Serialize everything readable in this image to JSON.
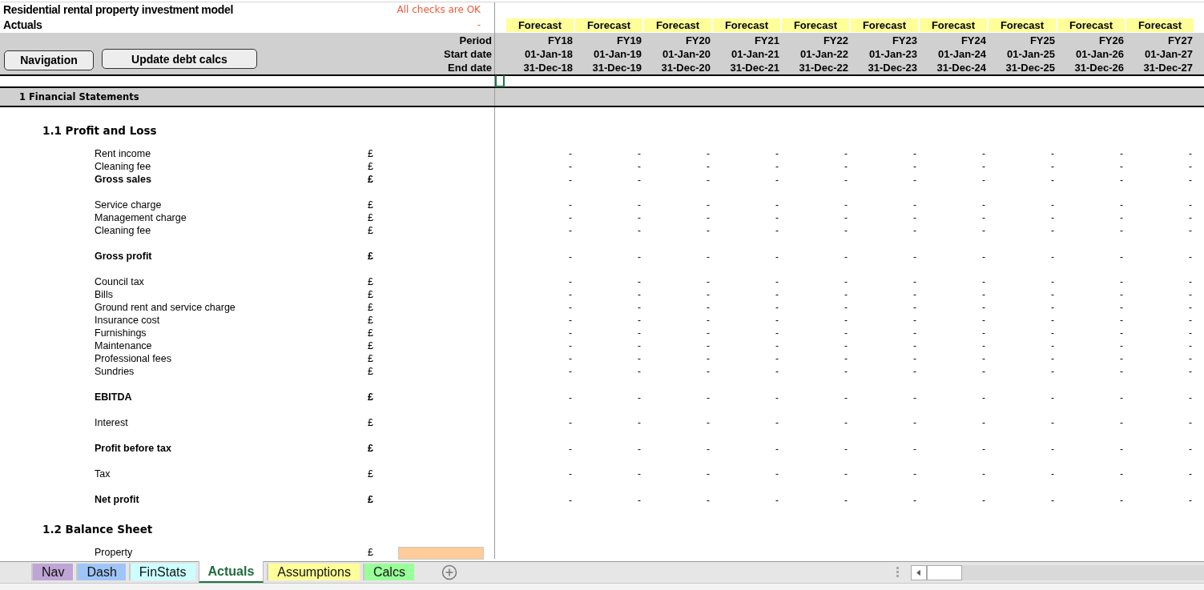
{
  "title": "Residential rental property investment model",
  "sheet_title": "Actuals",
  "check_status": "All checks are OK",
  "check_value": "-",
  "buttons": [
    "Navigation",
    "Update debt calcs"
  ],
  "header_labels": [
    "Period",
    "Start date",
    "End date"
  ],
  "periods": [
    {
      "flag": "Forecast",
      "period": "FY18",
      "start": "01-Jan-18",
      "end": "31-Dec-18"
    },
    {
      "flag": "Forecast",
      "period": "FY19",
      "start": "01-Jan-19",
      "end": "31-Dec-19"
    },
    {
      "flag": "Forecast",
      "period": "FY20",
      "start": "01-Jan-20",
      "end": "31-Dec-20"
    },
    {
      "flag": "Forecast",
      "period": "FY21",
      "start": "01-Jan-21",
      "end": "31-Dec-21"
    },
    {
      "flag": "Forecast",
      "period": "FY22",
      "start": "01-Jan-22",
      "end": "31-Dec-22"
    },
    {
      "flag": "Forecast",
      "period": "FY23",
      "start": "01-Jan-23",
      "end": "31-Dec-23"
    },
    {
      "flag": "Forecast",
      "period": "FY24",
      "start": "01-Jan-24",
      "end": "31-Dec-24"
    },
    {
      "flag": "Forecast",
      "period": "FY25",
      "start": "01-Jan-25",
      "end": "31-Dec-25"
    },
    {
      "flag": "Forecast",
      "period": "FY26",
      "start": "01-Jan-26",
      "end": "31-Dec-26"
    },
    {
      "flag": "Forecast",
      "period": "FY27",
      "start": "01-Jan-27",
      "end": "31-Dec-27"
    }
  ],
  "section": "1 Financial Statements",
  "subsections": [
    {
      "heading": "1.1 Profit and Loss",
      "rows": [
        {
          "kind": "item",
          "label": "Rent income",
          "unit": "£",
          "values": [
            "-",
            "-",
            "-",
            "-",
            "-",
            "-",
            "-",
            "-",
            "-",
            "-"
          ]
        },
        {
          "kind": "item",
          "label": "Cleaning fee",
          "unit": "£",
          "values": [
            "-",
            "-",
            "-",
            "-",
            "-",
            "-",
            "-",
            "-",
            "-",
            "-"
          ]
        },
        {
          "kind": "total",
          "label": "Gross sales",
          "unit": "£",
          "values": [
            "-",
            "-",
            "-",
            "-",
            "-",
            "-",
            "-",
            "-",
            "-",
            "-"
          ]
        },
        {
          "kind": "spacer"
        },
        {
          "kind": "item",
          "label": "Service charge",
          "unit": "£",
          "values": [
            "-",
            "-",
            "-",
            "-",
            "-",
            "-",
            "-",
            "-",
            "-",
            "-"
          ]
        },
        {
          "kind": "item",
          "label": "Management charge",
          "unit": "£",
          "values": [
            "-",
            "-",
            "-",
            "-",
            "-",
            "-",
            "-",
            "-",
            "-",
            "-"
          ]
        },
        {
          "kind": "item",
          "label": "Cleaning fee",
          "unit": "£",
          "values": [
            "-",
            "-",
            "-",
            "-",
            "-",
            "-",
            "-",
            "-",
            "-",
            "-"
          ]
        },
        {
          "kind": "spacer"
        },
        {
          "kind": "total",
          "label": "Gross profit",
          "unit": "£",
          "values": [
            "-",
            "-",
            "-",
            "-",
            "-",
            "-",
            "-",
            "-",
            "-",
            "-"
          ]
        },
        {
          "kind": "spacer"
        },
        {
          "kind": "item",
          "label": "Council tax",
          "unit": "£",
          "values": [
            "-",
            "-",
            "-",
            "-",
            "-",
            "-",
            "-",
            "-",
            "-",
            "-"
          ]
        },
        {
          "kind": "item",
          "label": "Bills",
          "unit": "£",
          "values": [
            "-",
            "-",
            "-",
            "-",
            "-",
            "-",
            "-",
            "-",
            "-",
            "-"
          ]
        },
        {
          "kind": "item",
          "label": "Ground rent and service charge",
          "unit": "£",
          "values": [
            "-",
            "-",
            "-",
            "-",
            "-",
            "-",
            "-",
            "-",
            "-",
            "-"
          ]
        },
        {
          "kind": "item",
          "label": "Insurance cost",
          "unit": "£",
          "values": [
            "-",
            "-",
            "-",
            "-",
            "-",
            "-",
            "-",
            "-",
            "-",
            "-"
          ]
        },
        {
          "kind": "item",
          "label": "Furnishings",
          "unit": "£",
          "values": [
            "-",
            "-",
            "-",
            "-",
            "-",
            "-",
            "-",
            "-",
            "-",
            "-"
          ]
        },
        {
          "kind": "item",
          "label": "Maintenance",
          "unit": "£",
          "values": [
            "-",
            "-",
            "-",
            "-",
            "-",
            "-",
            "-",
            "-",
            "-",
            "-"
          ]
        },
        {
          "kind": "item",
          "label": "Professional fees",
          "unit": "£",
          "values": [
            "-",
            "-",
            "-",
            "-",
            "-",
            "-",
            "-",
            "-",
            "-",
            "-"
          ]
        },
        {
          "kind": "item",
          "label": "Sundries",
          "unit": "£",
          "values": [
            "-",
            "-",
            "-",
            "-",
            "-",
            "-",
            "-",
            "-",
            "-",
            "-"
          ]
        },
        {
          "kind": "spacer"
        },
        {
          "kind": "total",
          "label": "EBITDA",
          "unit": "£",
          "values": [
            "-",
            "-",
            "-",
            "-",
            "-",
            "-",
            "-",
            "-",
            "-",
            "-"
          ]
        },
        {
          "kind": "spacer"
        },
        {
          "kind": "item",
          "label": "Interest",
          "unit": "£",
          "values": [
            "-",
            "-",
            "-",
            "-",
            "-",
            "-",
            "-",
            "-",
            "-",
            "-"
          ]
        },
        {
          "kind": "spacer"
        },
        {
          "kind": "total",
          "label": "Profit before tax",
          "unit": "£",
          "values": [
            "-",
            "-",
            "-",
            "-",
            "-",
            "-",
            "-",
            "-",
            "-",
            "-"
          ]
        },
        {
          "kind": "spacer"
        },
        {
          "kind": "item",
          "label": "Tax",
          "unit": "£",
          "values": [
            "-",
            "-",
            "-",
            "-",
            "-",
            "-",
            "-",
            "-",
            "-",
            "-"
          ]
        },
        {
          "kind": "spacer"
        },
        {
          "kind": "total",
          "label": "Net profit",
          "unit": "£",
          "values": [
            "-",
            "-",
            "-",
            "-",
            "-",
            "-",
            "-",
            "-",
            "-",
            "-"
          ]
        }
      ]
    },
    {
      "heading": "1.2 Balance Sheet",
      "rows": [
        {
          "kind": "input",
          "label": "Property",
          "unit": "£"
        }
      ]
    }
  ],
  "sheet_tabs": [
    {
      "label": "Nav",
      "color": "#bfa5d6",
      "selected": false
    },
    {
      "label": "Dash",
      "color": "#9fc5f8",
      "selected": false
    },
    {
      "label": "FinStats",
      "color": "#ccffff",
      "selected": false
    },
    {
      "label": "Actuals",
      "selected": true
    },
    {
      "label": "Assumptions",
      "color": "#ffff99",
      "selected": false
    },
    {
      "label": "Calcs",
      "color": "#99ff99",
      "selected": false
    }
  ]
}
